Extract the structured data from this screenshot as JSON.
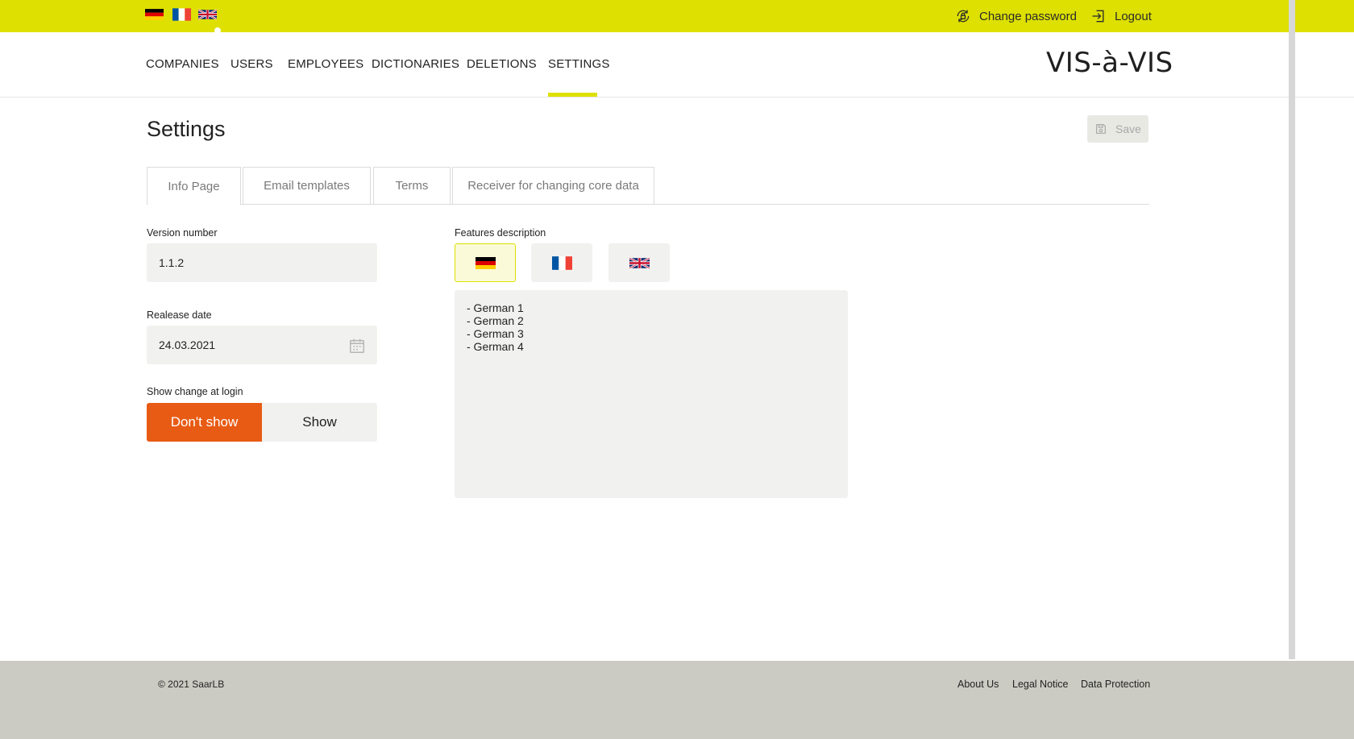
{
  "header": {
    "languages": [
      {
        "code": "de",
        "icon": "flag-germany-icon"
      },
      {
        "code": "fr",
        "icon": "flag-france-icon"
      },
      {
        "code": "en",
        "icon": "flag-uk-icon"
      }
    ],
    "active_language": "en",
    "change_password_label": "Change password",
    "logout_label": "Logout"
  },
  "nav": {
    "items": [
      {
        "label": "COMPANIES"
      },
      {
        "label": "USERS"
      },
      {
        "label": "EMPLOYEES"
      },
      {
        "label": "DICTIONARIES"
      },
      {
        "label": "DELETIONS"
      },
      {
        "label": "SETTINGS"
      }
    ],
    "active": "SETTINGS",
    "logo_text": "VIS-à-VIS"
  },
  "page": {
    "title": "Settings",
    "save_label": "Save",
    "tabs": [
      {
        "label": "Info Page"
      },
      {
        "label": "Email templates"
      },
      {
        "label": "Terms"
      },
      {
        "label": "Receiver for changing core data"
      }
    ],
    "active_tab": "Info Page"
  },
  "form": {
    "version_label": "Version number",
    "version_value": "1.1.2",
    "release_label": "Realease date",
    "release_value": "24.03.2021",
    "show_change_label": "Show change at login",
    "toggle_options": [
      "Don't show",
      "Show"
    ],
    "toggle_selected": "Don't show",
    "features_label": "Features description",
    "features_selected_language": "de",
    "features_text": "- German 1\n- German 2\n- German 3\n- German 4"
  },
  "footer": {
    "copyright": "© 2021 SaarLB",
    "links": [
      "About Us",
      "Legal Notice",
      "Data Protection"
    ]
  },
  "colors": {
    "accent": "#dde000",
    "toggle_active": "#e85b14",
    "input_bg": "#f1f1ef",
    "footer_bg": "#cbcbc3"
  }
}
